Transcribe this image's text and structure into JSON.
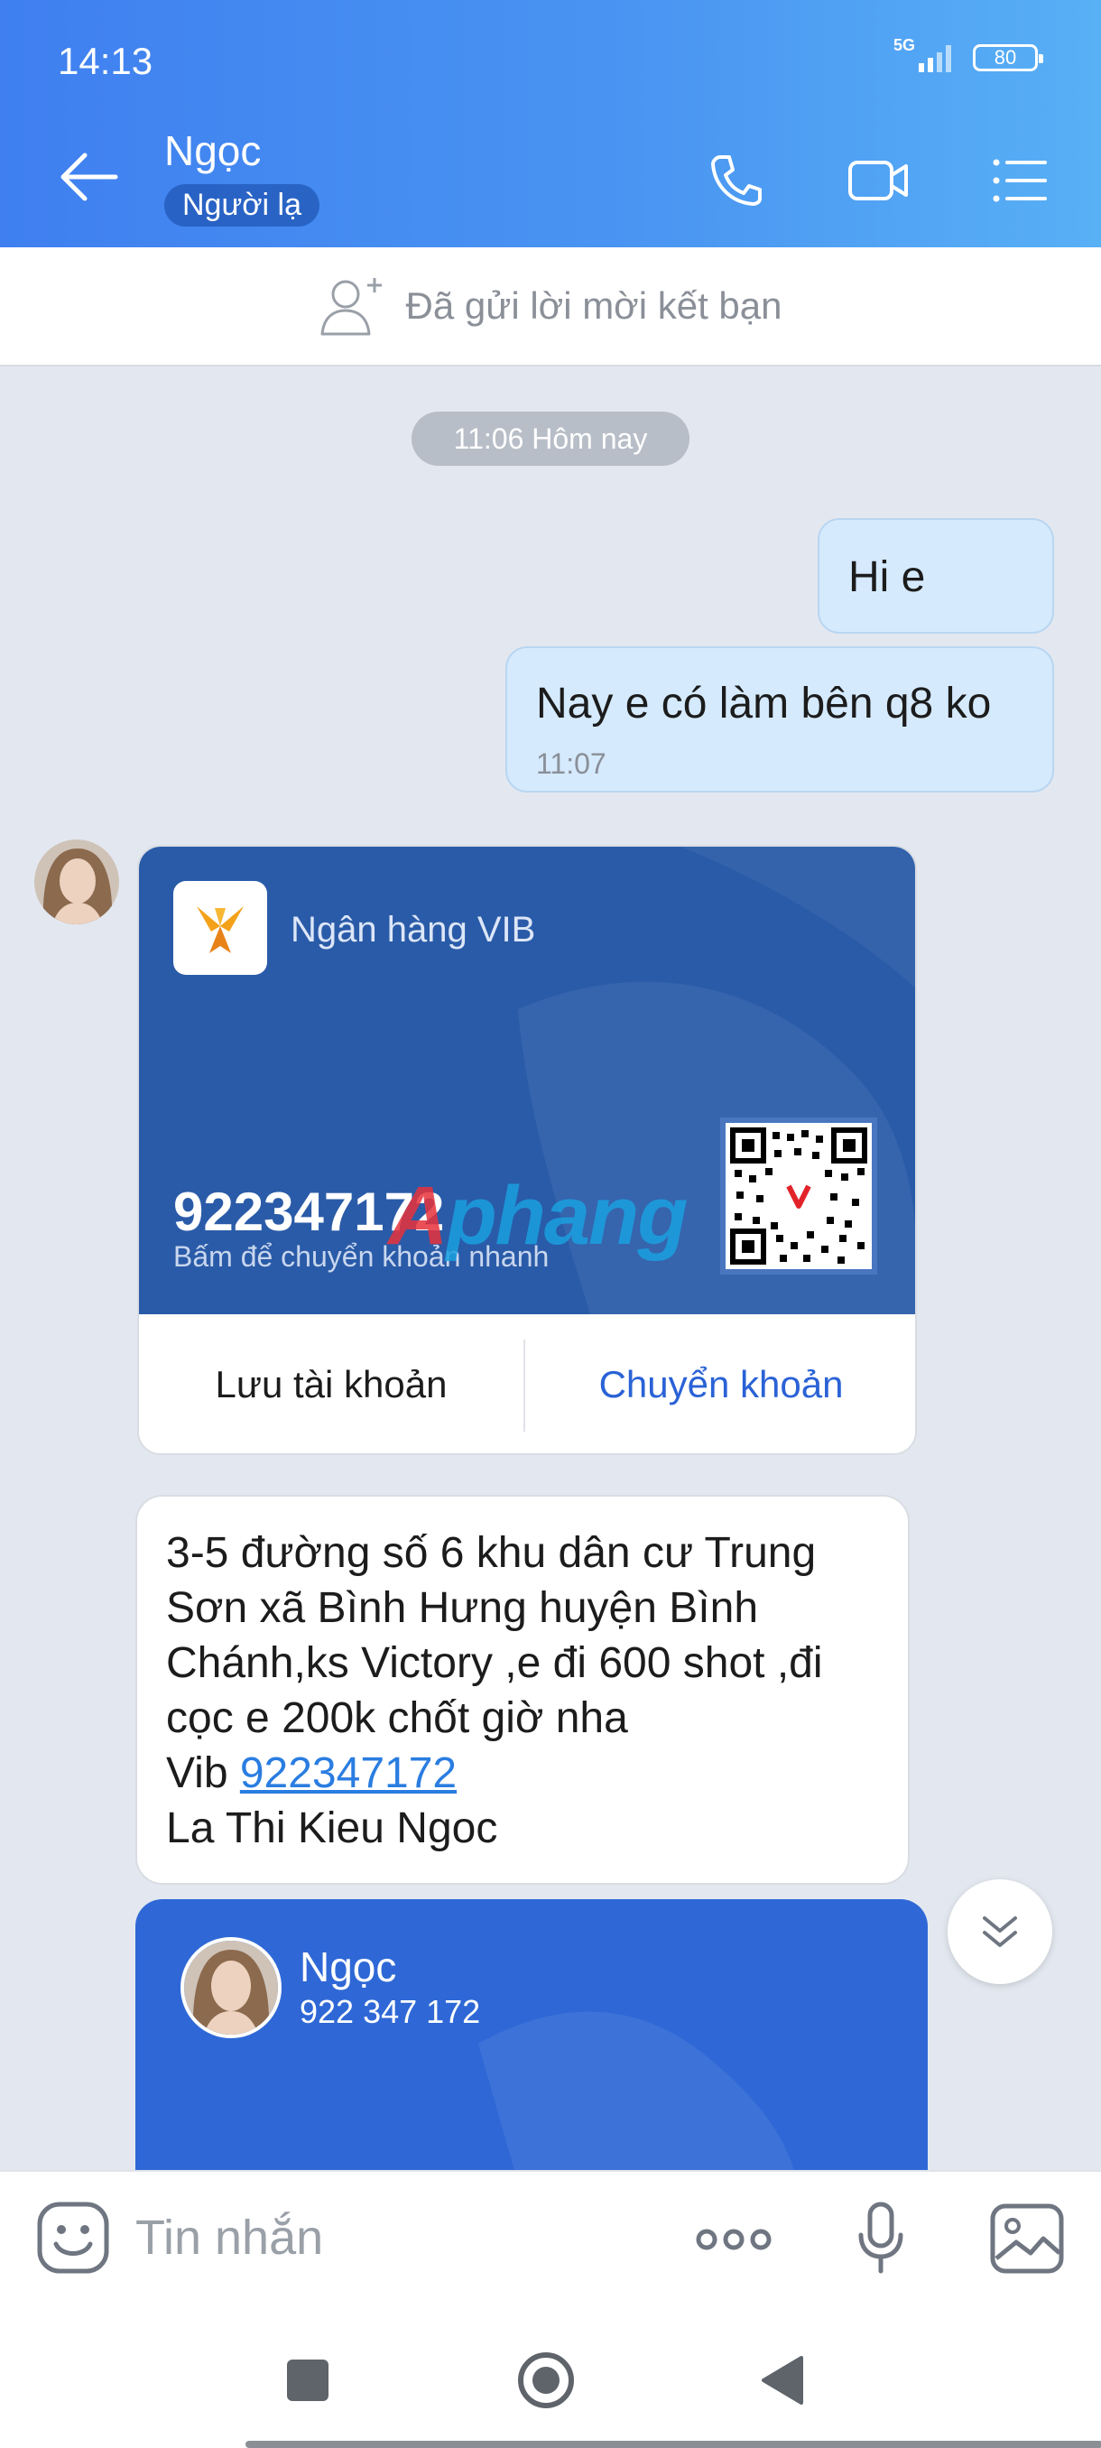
{
  "status_bar": {
    "time": "14:13",
    "network": "5G",
    "battery": "80"
  },
  "header": {
    "name": "Ngọc",
    "badge": "Người lạ"
  },
  "friend_request": {
    "text": "Đã gửi lời mời kết bạn"
  },
  "chat": {
    "time_divider": "11:06 Hôm nay",
    "messages_out": [
      {
        "text": "Hi e"
      },
      {
        "text": "Nay e có làm bên q8 ko",
        "time": "11:07"
      }
    ],
    "bank_card": {
      "bank_name": "Ngân hàng VIB",
      "account_number": "922347172",
      "hint": "Bấm để chuyển khoản nhanh",
      "save_label": "Lưu tài khoản",
      "transfer_label": "Chuyển khoản"
    },
    "message_in": {
      "lines": [
        "3-5 đường số 6 khu dân cư Trung",
        "Sơn xã Bình Hưng huyện Bình",
        "Chánh,ks Victory ,e đi 600 shot ,đi",
        "cọc e 200k chốt giờ nha"
      ],
      "bank_prefix": "Vib ",
      "bank_link": "922347172",
      "owner": "La Thi Kieu Ngoc"
    },
    "contact_card": {
      "name": "Ngọc",
      "phone": "922 347 172"
    }
  },
  "watermark": {
    "part1": "A",
    "part2": "phang"
  },
  "input": {
    "placeholder": "Tin nhắn"
  },
  "colors": {
    "header_start": "#3f7ff0",
    "header_end": "#58b0f5",
    "bank_card": "#2a5ba8",
    "link": "#2a7de1",
    "outgoing_bubble": "#d5eafd"
  }
}
